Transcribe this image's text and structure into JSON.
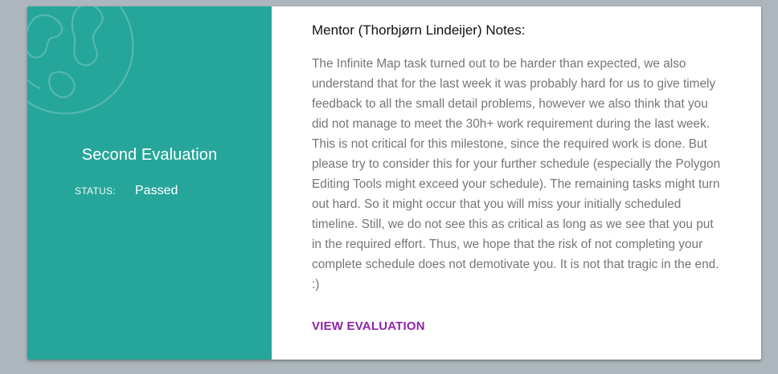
{
  "evaluation": {
    "title": "Second Evaluation",
    "status_label": "STATUS:",
    "status_value": "Passed"
  },
  "notes": {
    "heading": "Mentor (Thorbjørn Lindeijer) Notes:",
    "body": "The Infinite Map task turned out to be harder than expected, we also understand that for the last week it was probably hard for us to give timely feedback to all the small detail problems, however we also think that you did not manage to meet the 30h+ work requirement during the last week. This is not critical for this milestone, since the required work is done. But please try to consider this for your further schedule (especially the Polygon Editing Tools might exceed your schedule). The remaining tasks might turn out hard. So it might occur that you will miss your initially scheduled timeline. Still, we do not see this as critical as long as we see that you put in the required effort. Thus, we hope that the risk of not completing your complete schedule does not demotivate you. It is not that tragic in the end. :)"
  },
  "actions": {
    "view_label": "VIEW EVALUATION"
  },
  "colors": {
    "background": "#adb6bc",
    "panel": "#26a69a",
    "link": "#8e24aa"
  },
  "icons": {
    "decoration": "globe-icon"
  }
}
